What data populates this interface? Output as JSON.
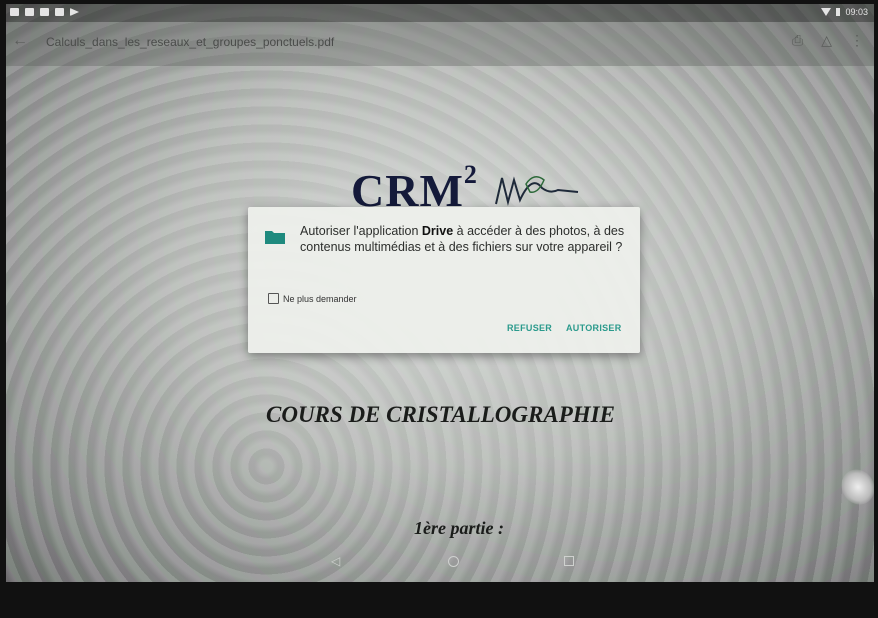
{
  "status_bar": {
    "time": "09:03"
  },
  "app_bar": {
    "filename": "Calculs_dans_les_reseaux_et_groupes_ponctuels.pdf"
  },
  "document": {
    "logo_text": "CRM",
    "logo_superscript": "2",
    "course_title": "COURS DE CRISTALLOGRAPHIE",
    "part": "1ère partie :"
  },
  "dialog": {
    "message_prefix": "Autoriser l'application ",
    "app_name": "Drive",
    "message_suffix": " à accéder à des photos, à des contenus multimédias et à des fichiers sur votre appareil ?",
    "checkbox_label": "Ne plus demander",
    "checkbox_checked": false,
    "deny_label": "REFUSER",
    "allow_label": "AUTORISER",
    "accent_color": "#2a9a8c",
    "folder_icon_color": "#1e8a7e"
  },
  "nav_bar": {
    "back_icon": "triangle-back-icon",
    "home_icon": "circle-home-icon",
    "recents_icon": "square-recents-icon"
  }
}
